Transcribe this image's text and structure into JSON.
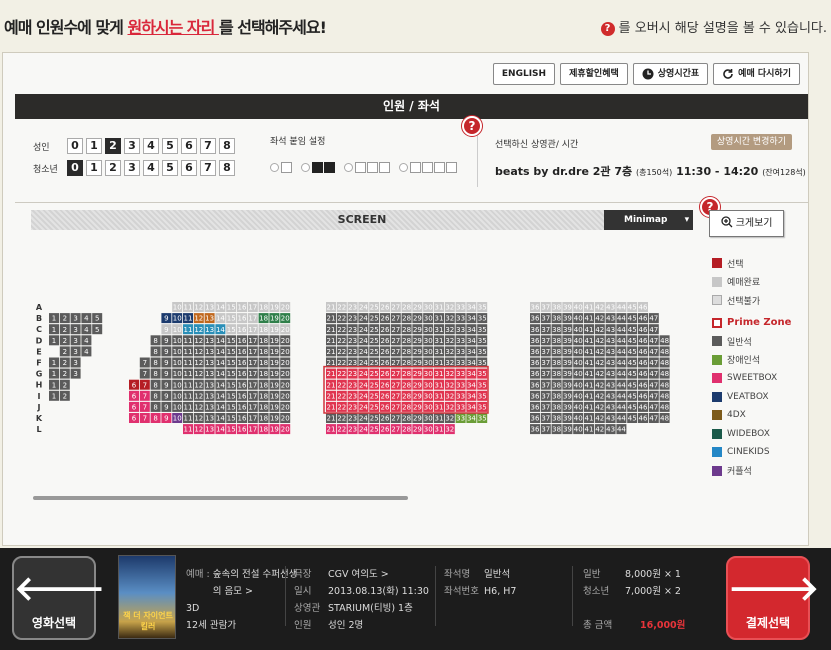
{
  "header": {
    "title_pre": "예매 인원수에 맞게 ",
    "title_em": "원하시는 자리 ",
    "title_post": "를 선택해주세요!",
    "hint_icon": "?",
    "hint_text": "를 오버시 해당 설명을 볼 수 있습니다."
  },
  "toolbar": {
    "english": "ENGLISH",
    "discount": "제휴할인혜택",
    "schedule": "상영시간표",
    "restart": "예매 다시하기"
  },
  "section_title": "인원 / 좌석",
  "people": {
    "adult_label": "성인",
    "youth_label": "청소년",
    "numbers": [
      "0",
      "1",
      "2",
      "3",
      "4",
      "5",
      "6",
      "7",
      "8"
    ],
    "adult_selected": "2",
    "youth_selected": "0"
  },
  "seat_options": {
    "title": "좌석 붙임 설정"
  },
  "selection": {
    "label": "선택하신 상영관/ 시간",
    "change_button": "상영시간 변경하기",
    "movie": "beats by dr.dre 2관 7층",
    "seats_total": "(총150석)",
    "time": "11:30 - 14:20",
    "remaining": "(잔여128석)"
  },
  "screen_label": "SCREEN",
  "minimap_label": "Minimap",
  "zoom_label": "크게보기",
  "help_marker": "?",
  "row_labels": [
    "A",
    "B",
    "C",
    "D",
    "E",
    "F",
    "G",
    "H",
    "I",
    "J",
    "K",
    "L"
  ],
  "legend": {
    "selected": "선택",
    "sold": "예매완료",
    "unavailable": "선택불가",
    "prime": "Prime Zone",
    "normal": "일반석",
    "disabled": "장애인석",
    "sweetbox": "SWEETBOX",
    "veatbox": "VEATBOX",
    "fourdx": "4DX",
    "widebox": "WIDEBOX",
    "cinekids": "CINEKIDS",
    "couple": "커플석"
  },
  "colors": {
    "normal": "#5b5b5b",
    "sold": "#c7c7c7",
    "prime_border": "#d1333b",
    "prime_fill": "#e0344f",
    "selected": "#b51d24",
    "disabled": "#6a9d36",
    "sweetbox": "#e0306e",
    "veatbox": "#1c3b6e",
    "fourdx": "#7d5b1b",
    "widebox": "#1b5a4a",
    "cinekids": "#2487c6",
    "couple": "#6d3a8d",
    "green": "#2f7f4a",
    "teal": "#2a8fb8",
    "orange": "#c0681e"
  },
  "footer": {
    "back_label": "영화선택",
    "pay_label": "결제선택",
    "poster_text": "잭 더 자이언트 킬러",
    "movie_title_k": "예매 :",
    "movie_title": "숲속의 전설 수퍼선생의 음모 >",
    "format": "3D",
    "rating": "12세 관람가",
    "theater_k": "극장",
    "theater": "CGV 여의도 >",
    "date_k": "일시",
    "date": "2013.08.13(화) 11:30",
    "hall_k": "상영관",
    "hall": "STARIUM(티빙) 1층",
    "people_k": "인원",
    "people": "성인 2명",
    "seat_type_k": "좌석명",
    "seat_type": "일반석",
    "seat_no_k": "좌석번호",
    "seat_no": "H6, H7",
    "adult_k": "일반",
    "adult_price": "8,000원 × 1",
    "youth_k": "청소년",
    "youth_price": "7,000원 × 2",
    "total_k": "총 금액",
    "total": "16,000원"
  }
}
